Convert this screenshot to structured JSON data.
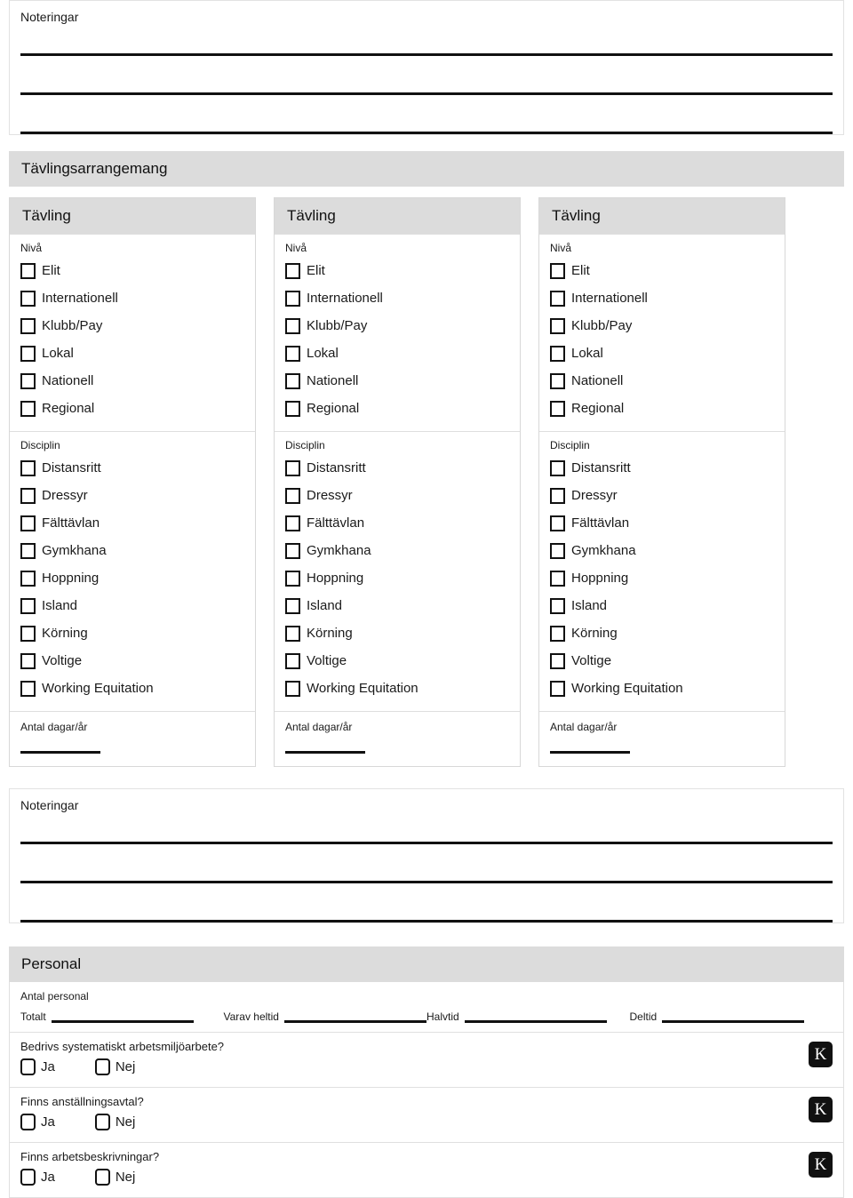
{
  "notes_top": {
    "label": "Noteringar",
    "line_count": 3
  },
  "competition_section": {
    "title": "Tävlingsarrangemang",
    "columns": [
      {
        "header": "Tävling",
        "level": {
          "label": "Nivå",
          "options": [
            "Elit",
            "Internationell",
            "Klubb/Pay",
            "Lokal",
            "Nationell",
            "Regional"
          ]
        },
        "discipline": {
          "label": "Disciplin",
          "options": [
            "Distansritt",
            "Dressyr",
            "Fälttävlan",
            "Gymkhana",
            "Hoppning",
            "Island",
            "Körning",
            "Voltige",
            "Working Equitation"
          ]
        },
        "days": {
          "label": "Antal dagar/år",
          "value": ""
        }
      },
      {
        "header": "Tävling",
        "level": {
          "label": "Nivå",
          "options": [
            "Elit",
            "Internationell",
            "Klubb/Pay",
            "Lokal",
            "Nationell",
            "Regional"
          ]
        },
        "discipline": {
          "label": "Disciplin",
          "options": [
            "Distansritt",
            "Dressyr",
            "Fälttävlan",
            "Gymkhana",
            "Hoppning",
            "Island",
            "Körning",
            "Voltige",
            "Working Equitation"
          ]
        },
        "days": {
          "label": "Antal dagar/år",
          "value": ""
        }
      },
      {
        "header": "Tävling",
        "level": {
          "label": "Nivå",
          "options": [
            "Elit",
            "Internationell",
            "Klubb/Pay",
            "Lokal",
            "Nationell",
            "Regional"
          ]
        },
        "discipline": {
          "label": "Disciplin",
          "options": [
            "Distansritt",
            "Dressyr",
            "Fälttävlan",
            "Gymkhana",
            "Hoppning",
            "Island",
            "Körning",
            "Voltige",
            "Working Equitation"
          ]
        },
        "days": {
          "label": "Antal dagar/år",
          "value": ""
        }
      }
    ]
  },
  "notes_bottom": {
    "label": "Noteringar",
    "line_count": 3
  },
  "personal_section": {
    "title": "Personal",
    "staff_count": {
      "label": "Antal personal",
      "fields": [
        {
          "name": "Totalt",
          "value": ""
        },
        {
          "name": "Varav heltid",
          "value": ""
        },
        {
          "name": "Halvtid",
          "value": ""
        },
        {
          "name": "Deltid",
          "value": ""
        }
      ]
    },
    "questions": [
      {
        "text": "Bedrivs systematiskt arbetsmiljöarbete?",
        "options": [
          "Ja",
          "Nej"
        ],
        "badge": "K"
      },
      {
        "text": "Finns anställningsavtal?",
        "options": [
          "Ja",
          "Nej"
        ],
        "badge": "K"
      },
      {
        "text": "Finns arbetsbeskrivningar?",
        "options": [
          "Ja",
          "Nej"
        ],
        "badge": "K"
      }
    ]
  },
  "colors": {
    "header_gray": "#dcdcdc",
    "border_gray": "#d8d8d8",
    "rule_black": "#111111",
    "badge_bg": "#111111"
  }
}
